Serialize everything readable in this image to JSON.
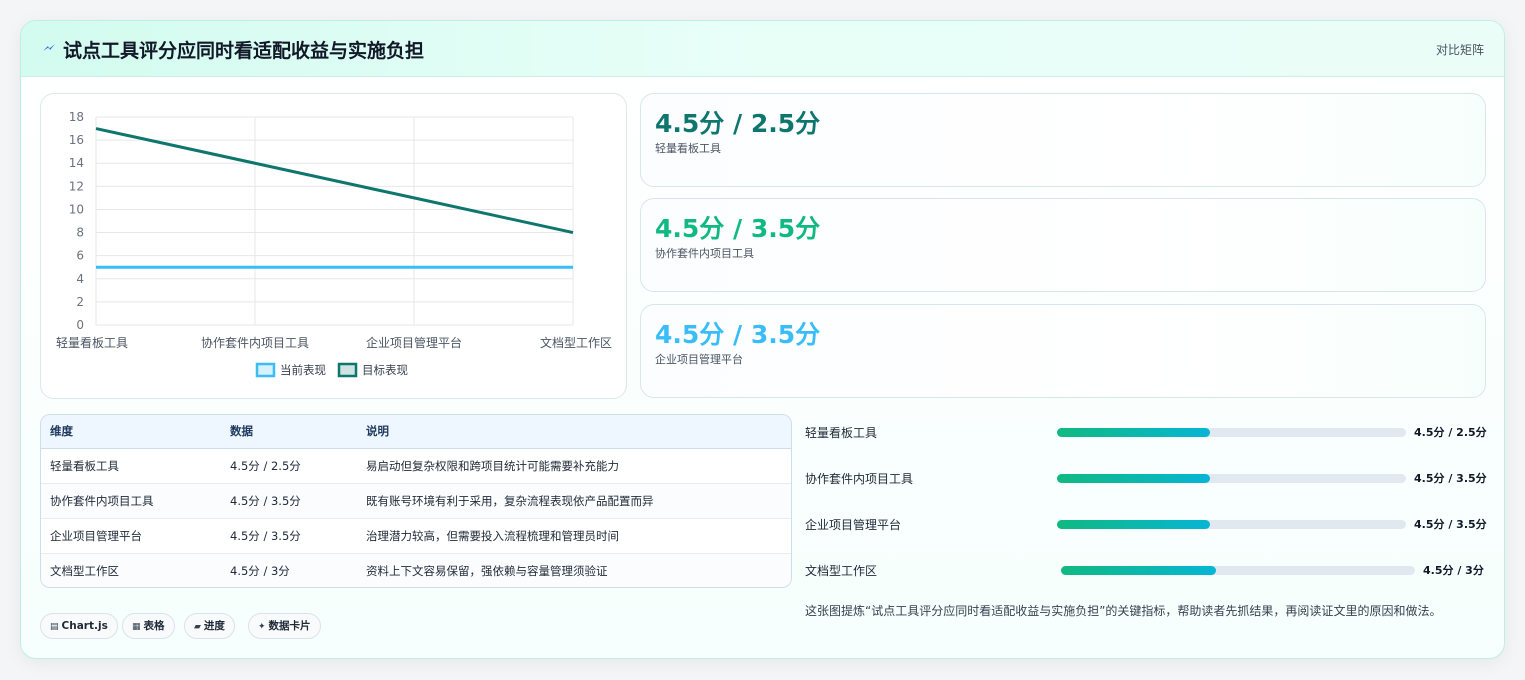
{
  "header": {
    "title": "试点工具评分应同时看适配收益与实施负担",
    "right_label": "对比矩阵",
    "icon": "lightning-icon"
  },
  "chart_data": {
    "type": "line",
    "categories": [
      "轻量看板工具",
      "协作套件内项目工具",
      "企业项目管理平台",
      "文档型工作区"
    ],
    "series": [
      {
        "name": "当前表现",
        "values": [
          5,
          5,
          5,
          5
        ],
        "color": "#38bdf8"
      },
      {
        "name": "目标表现",
        "values": [
          17,
          14,
          11,
          8
        ],
        "color": "#0f766e"
      }
    ],
    "ylim": [
      0,
      18
    ],
    "yticks": [
      "0",
      "2",
      "4",
      "6",
      "8",
      "10",
      "12",
      "14",
      "16",
      "18"
    ],
    "grid": true,
    "legend": "bottom"
  },
  "kpis": [
    {
      "value": "4.5分 / 2.5分",
      "label": "轻量看板工具",
      "color": "#0f766e"
    },
    {
      "value": "4.5分 / 3.5分",
      "label": "协作套件内项目工具",
      "color": "#10b981"
    },
    {
      "value": "4.5分 / 3.5分",
      "label": "企业项目管理平台",
      "color": "#38bdf8"
    }
  ],
  "table": {
    "headers": [
      "维度",
      "数据",
      "说明"
    ],
    "rows": [
      [
        "轻量看板工具",
        "4.5分 / 2.5分",
        "易启动但复杂权限和跨项目统计可能需要补充能力"
      ],
      [
        "协作套件内项目工具",
        "4.5分 / 3.5分",
        "既有账号环境有利于采用，复杂流程表现依产品配置而异"
      ],
      [
        "企业项目管理平台",
        "4.5分 / 3.5分",
        "治理潜力较高，但需要投入流程梳理和管理员时间"
      ],
      [
        "文档型工作区",
        "4.5分 / 3分",
        "资料上下文容易保留，强依赖与容量管理须验证"
      ]
    ]
  },
  "progress": [
    {
      "label": "轻量看板工具",
      "value": "4.5分 / 2.5分",
      "fill": 0.437
    },
    {
      "label": "协作套件内项目工具",
      "value": "4.5分 / 3.5分",
      "fill": 0.437
    },
    {
      "label": "企业项目管理平台",
      "value": "4.5分 / 3.5分",
      "fill": 0.437
    },
    {
      "label": "文档型工作区",
      "value": "4.5分 / 3分",
      "fill": 0.437
    }
  ],
  "tags": [
    {
      "glyph": "▤",
      "label": "Chart.js"
    },
    {
      "glyph": "▦",
      "label": "表格"
    },
    {
      "glyph": "▰",
      "label": "进度"
    },
    {
      "glyph": "✦",
      "label": "数据卡片"
    }
  ],
  "summary": "这张图提炼“试点工具评分应同时看适配收益与实施负担”的关键指标，帮助读者先抓结果，再阅读证文里的原因和做法。"
}
